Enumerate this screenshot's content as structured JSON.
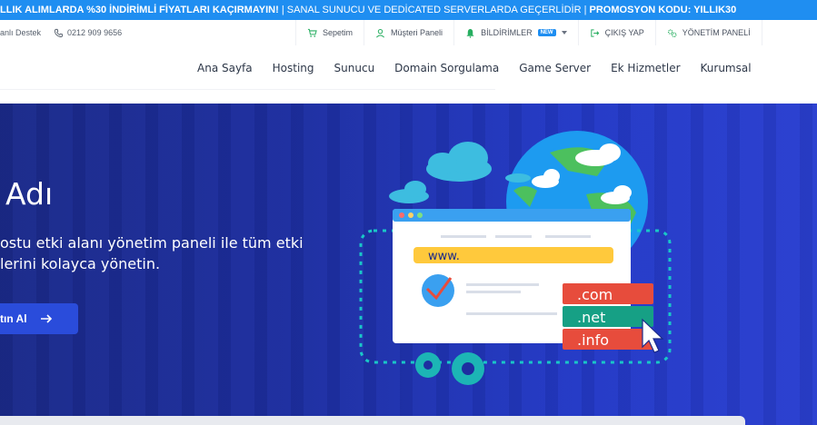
{
  "promo": {
    "part1": "LLIK ALIMLARDA %30 İNDİRİMLİ FİYATLARI KAÇIRMAYIN!",
    "sep1": " | ",
    "part2": "SANAL SUNUCU VE DEDİCATED SERVERLARDA GEÇERLİDİR",
    "sep2": " | ",
    "part3": "PROMOSYON KODU: YILLIK30"
  },
  "util": {
    "support": "anlı Destek",
    "phone": "0212 909 9656",
    "cart": "Sepetim",
    "customer_panel": "Müşteri Paneli",
    "notifications": "BİLDİRİMLER",
    "new_badge": "NEW",
    "logout": "ÇIKIŞ YAP",
    "admin_panel": "YÖNETİM PANELİ"
  },
  "nav": {
    "items": [
      "Ana Sayfa",
      "Hosting",
      "Sunucu",
      "Domain Sorgulama",
      "Game Server",
      "Ek Hizmetler",
      "Kurumsal"
    ]
  },
  "hero": {
    "title": "Adı",
    "desc_line1": "ostu etki alanı yönetim paneli ile tüm etki",
    "desc_line2": "lerini kolayca yönetin.",
    "cta": "tın Al",
    "illus_www": "www.",
    "illus_com": ".com",
    "illus_net": ".net",
    "illus_info": ".info"
  },
  "colors": {
    "promo_bg": "#1f8ef1",
    "hero_bg": "#1d2ea0",
    "accent_green": "#27ae60",
    "tld_red": "#e74c3c",
    "tld_teal": "#16a085"
  }
}
